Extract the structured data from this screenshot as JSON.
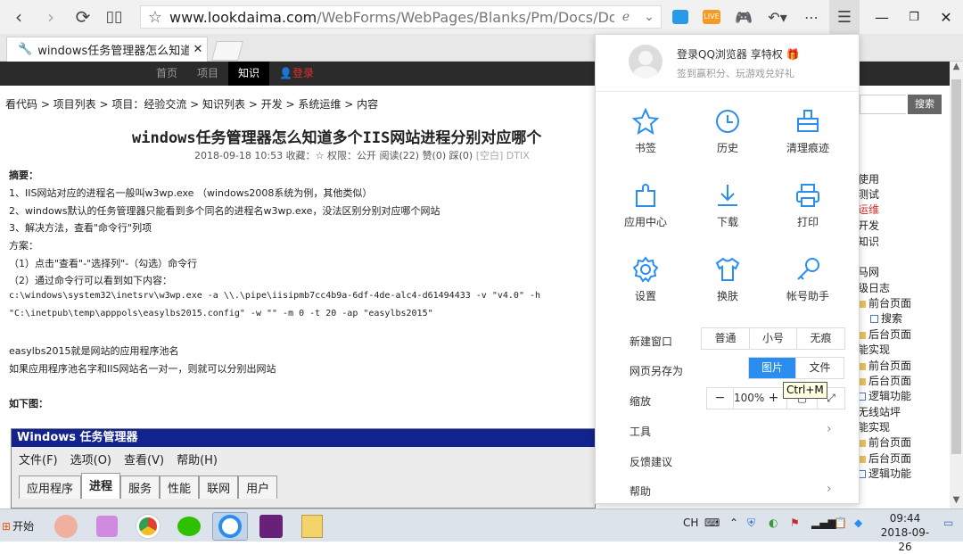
{
  "browser": {
    "url_host": "www.lookdaima.com",
    "url_path": "/WebForms/WebPages/Blanks/Pm/Docs/DocItemD",
    "menu_icon": "hamburger-icon",
    "tab_title": "windows任务管理器怎么知道多个"
  },
  "sitenav": {
    "items": [
      "首页",
      "项目",
      "知识",
      "登录"
    ]
  },
  "page": {
    "breadcrumb": "看代码 > 项目列表 > 项目：经验交流 > 知识列表 > 开发 > 系统运维 > 内容",
    "title": "windows任务管理器怎么知道多个IIS网站进程分别对应哪个",
    "meta_left": "2018-09-18 10:53 收藏：☆ 权限：公开 阅读(22) 赞(0) 踩(0)",
    "meta_right": "[空白] DTIX",
    "lines": [
      "摘要：",
      "1、IIS网站对应的进程名一般叫w3wp.exe （windows2008系统为例，其他类似）",
      "2、windows默认的任务管理器只能看到多个同名的进程名w3wp.exe，没法区别分别对应哪个网站",
      "3、解决方法，查看\"命令行\"列项",
      "方案：",
      "（1）点击\"查看\"-\"选择列\"-（勾选）命令行",
      "（2）通过命令行可以看到如下内容：",
      "c:\\windows\\system32\\inetsrv\\w3wp.exe -a \\\\.\\pipe\\iisipmb7cc4b9a-6df-4de-alc4-d61494433 -v \"v4.0\" -h",
      "\"C:\\inetpub\\temp\\apppols\\easylbs2015.config\" -w \"\" -m 0 -t 20 -ap \"easylbs2015\"",
      "easylbs2015就是网站的应用程序池名",
      "如果应用程序池名字和IIS网站名一对一，则就可以分别出网站",
      "如下图："
    ],
    "search_label": "搜索",
    "sidebar": [
      "使用",
      "测试",
      "运维",
      "开发",
      "知识",
      "马网",
      "级日志",
      "前台页面",
      "搜索",
      "后台页面",
      "能实现",
      "前台页面",
      "后台页面",
      "逻辑功能",
      "无线站坪",
      "能实现",
      "前台页面",
      "后台页面",
      "逻辑功能"
    ]
  },
  "taskmgr": {
    "title": "Windows 任务管理器",
    "menu": [
      "文件(F)",
      "选项(O)",
      "查看(V)",
      "帮助(H)"
    ],
    "tabs": [
      "应用程序",
      "进程",
      "服务",
      "性能",
      "联网",
      "用户"
    ]
  },
  "panel": {
    "login": "登录QQ浏览器 享特权",
    "signin": "签到赢积分、玩游戏兑好礼",
    "grid": [
      {
        "label": "书签",
        "icon": "star-icon"
      },
      {
        "label": "历史",
        "icon": "clock-icon"
      },
      {
        "label": "清理痕迹",
        "icon": "eraser-icon"
      },
      {
        "label": "应用中心",
        "icon": "puzzle-icon"
      },
      {
        "label": "下载",
        "icon": "download-icon"
      },
      {
        "label": "打印",
        "icon": "printer-icon"
      },
      {
        "label": "设置",
        "icon": "gear-icon"
      },
      {
        "label": "换肤",
        "icon": "shirt-icon"
      },
      {
        "label": "帐号助手",
        "icon": "key-icon"
      }
    ],
    "new_window": {
      "label": "新建窗口",
      "options": [
        "普通",
        "小号",
        "无痕"
      ]
    },
    "save_as": {
      "label": "网页另存为",
      "options": [
        "图片",
        "文件"
      ],
      "selected": "图片"
    },
    "zoom": {
      "label": "缩放",
      "minus": "−",
      "value": "100%",
      "plus": "+"
    },
    "tools": "工具",
    "feedback": "反馈建议",
    "help": "帮助",
    "tooltip": "Ctrl+M"
  },
  "taskbar": {
    "start": "开始",
    "lang": "CH",
    "time": "09:44",
    "date": "2018-09-26"
  },
  "colors": {
    "accent": "#2a8ef0",
    "nav_bg": "#2b2b2b",
    "taskmgr_title": "#12238f"
  }
}
